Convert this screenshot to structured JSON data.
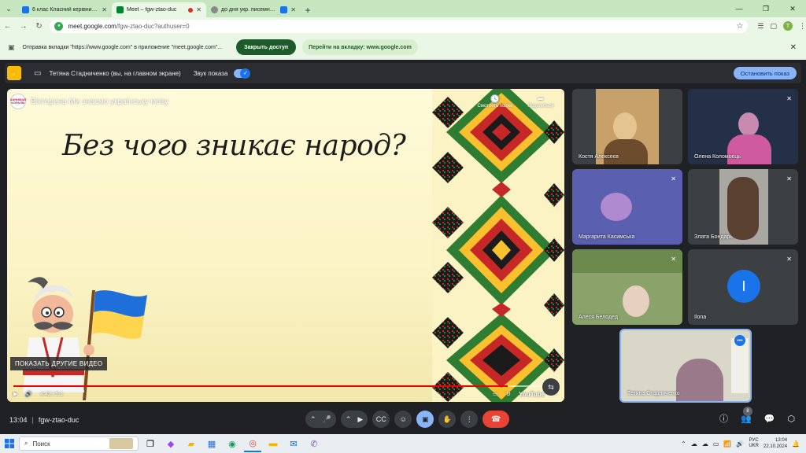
{
  "browser": {
    "tabs": [
      {
        "title": "6 клас Класний керівник Кузь",
        "favicon_color": "#1a73e8",
        "active": false
      },
      {
        "title": "Meet – fgw-ztao-duc",
        "favicon_color": "#00832d",
        "active": true
      },
      {
        "title": "до дня укр. писемності та",
        "favicon_color": "#888888",
        "active": false
      }
    ],
    "new_tab": "+",
    "url_domain": "meet.google.com",
    "url_path": "/fgw-ztao-duc?authuser=0",
    "profile_initial": "T"
  },
  "share_bar": {
    "message": "Отправка вкладки \"https://www.google.com\" в приложение \"meet.google.com\"...",
    "stop_sharing": "Закрыть доступ",
    "go_to_tab": "Перейти на вкладку: www.google.com"
  },
  "presenting_bar": {
    "presenter": "Тетяна Стадниченко (вы, на главном экране)",
    "audio_label": "Звук показа",
    "stop_button": "Остановить показ"
  },
  "presentation": {
    "channel_badge": "ЗАНИМАЙ КОРАЛІК",
    "video_title": "Вікторина Ми знаємо українську мову",
    "watch_later": "Смотреть позже",
    "share": "Поделиться",
    "question": "Без чого зникає народ?",
    "more_videos": "ПОКАЗАТЬ ДРУГИЕ ВИДЕО",
    "time": "4:42 / 5:1",
    "progress_fraction": 0.91,
    "youtube": "YouTube"
  },
  "participants": [
    {
      "name": "Костя Алексеєв",
      "muted": false,
      "bg": "#c7a06a",
      "face": "#e4c490"
    },
    {
      "name": "Олена Коломоєць",
      "muted": true,
      "bg": "#243048",
      "face": "#c98ab0"
    },
    {
      "name": "Маргарита Касимська",
      "muted": true,
      "bg": "#5a5fb0",
      "face": "#b08ad0"
    },
    {
      "name": "Злата Бондарь",
      "muted": true,
      "bg": "#a9a7a2",
      "face": "#5a4030"
    },
    {
      "name": "Алеся Белодед",
      "muted": true,
      "bg": "#8aa36a",
      "face": "#e8d0c0"
    },
    {
      "name": "Ilona",
      "muted": true,
      "initial": "I"
    },
    {
      "name": "Тетяна Стадниченко",
      "self": true,
      "bg": "#d9d7c8",
      "face": "#9a7a8a"
    }
  ],
  "meet_bar": {
    "time": "13:04",
    "separator": "|",
    "meeting_code": "fgw-ztao-duc",
    "people_count": "8"
  },
  "taskbar": {
    "search_placeholder": "Поиск",
    "lang_top": "РУС",
    "lang_bottom": "UKR",
    "clock_time": "13:04",
    "clock_date": "22.10.2024"
  }
}
